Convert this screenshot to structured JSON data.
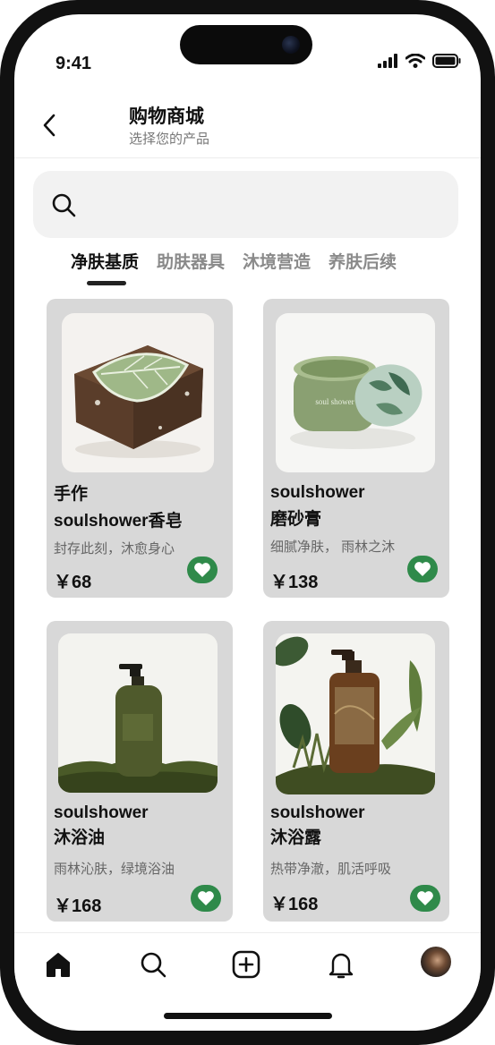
{
  "status_bar": {
    "time": "9:41"
  },
  "header": {
    "title": "购物商城",
    "subtitle": "选择您的产品"
  },
  "search": {
    "placeholder": ""
  },
  "tabs": [
    {
      "label": "净肤基质",
      "active": true
    },
    {
      "label": "助肤器具",
      "active": false
    },
    {
      "label": "沐境营造",
      "active": false
    },
    {
      "label": "养肤后续",
      "active": false
    }
  ],
  "products": [
    {
      "name_line1": "手作",
      "name_line2": "soulshower香皂",
      "desc": "封存此刻，沐愈身心",
      "price": "￥68",
      "favorited": true
    },
    {
      "name_line1": "soulshower",
      "name_line2": "磨砂膏",
      "desc": "细腻净肤， 雨林之沐",
      "price": "￥138",
      "favorited": true
    },
    {
      "name_line1": "soulshower",
      "name_line2": "沐浴油",
      "desc": "雨林沁肤，绿境浴油",
      "price": "￥168",
      "favorited": true
    },
    {
      "name_line1": "soulshower",
      "name_line2": "沐浴露",
      "desc": "热带净澈，肌活呼吸",
      "price": "￥168",
      "favorited": true
    }
  ],
  "product_images": {
    "jar_label": "soul shower"
  },
  "bottom_nav": [
    "home-icon",
    "search-icon",
    "add-icon",
    "bell-icon",
    "avatar"
  ],
  "colors": {
    "accent": "#2f8a4a",
    "card_bg": "#d8d8d8"
  }
}
